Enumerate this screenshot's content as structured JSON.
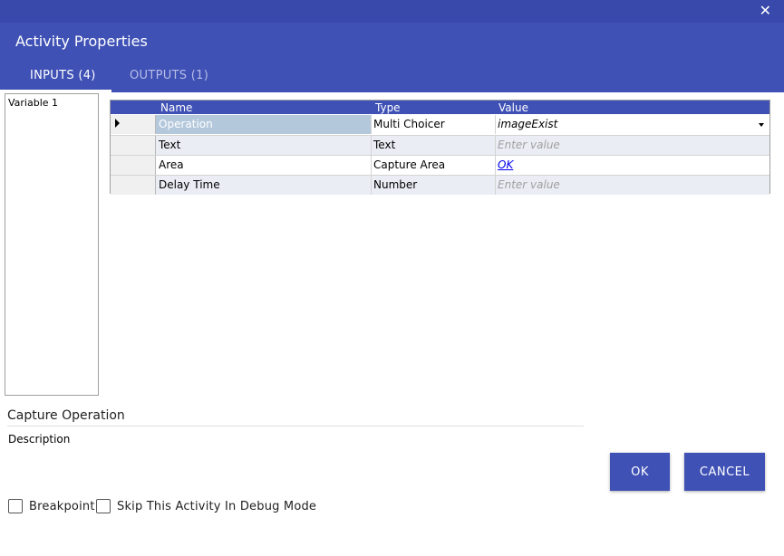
{
  "window": {
    "close_glyph": "✕",
    "title": "Activity Properties"
  },
  "tabs": [
    {
      "label": "INPUTS (4)",
      "active": true
    },
    {
      "label": "OUTPUTS (1)",
      "active": false
    }
  ],
  "variables": [
    "Variable 1"
  ],
  "grid": {
    "columns": [
      "Name",
      "Type",
      "Value"
    ],
    "rows": [
      {
        "name": "Operation",
        "type": "Multi Choicer",
        "value": "imageExist",
        "placeholder": ""
      },
      {
        "name": "Text",
        "type": "Text",
        "value": "",
        "placeholder": "Enter value"
      },
      {
        "name": "Area",
        "type": "Capture Area",
        "value": "OK",
        "placeholder": ""
      },
      {
        "name": "Delay Time",
        "type": "Number",
        "value": "",
        "placeholder": "Enter value"
      }
    ]
  },
  "description": {
    "title": "Capture Operation",
    "label": "Description"
  },
  "buttons": {
    "ok": "OK",
    "cancel": "CANCEL"
  },
  "options": {
    "breakpoint": "Breakpoint",
    "skip_debug": "Skip This Activity In Debug Mode"
  },
  "colors": {
    "primary": "#3f51b5",
    "titlebar": "#3949ab",
    "selection": "#b4c8dc"
  },
  "icons": {
    "close": "close-icon",
    "row_indicator": "caret-right-icon",
    "dropdown": "chevron-down-icon"
  }
}
